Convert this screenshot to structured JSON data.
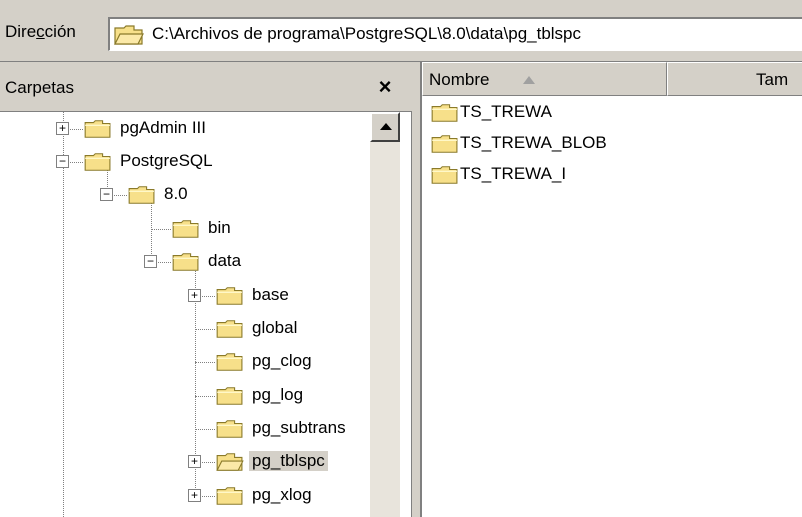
{
  "addressbar": {
    "label_prefix": "Dire",
    "label_accel": "c",
    "label_suffix": "ción",
    "path": "C:\\Archivos de programa\\PostgreSQL\\8.0\\data\\pg_tblspc"
  },
  "leftpane": {
    "title": "Carpetas",
    "close_glyph": "×"
  },
  "tree": [
    {
      "label": "pgAdmin III",
      "expander": "+"
    },
    {
      "label": "PostgreSQL",
      "expander": "−"
    },
    {
      "label": "8.0",
      "expander": "−"
    },
    {
      "label": "bin",
      "expander": ""
    },
    {
      "label": "data",
      "expander": "−"
    },
    {
      "label": "base",
      "expander": "+"
    },
    {
      "label": "global",
      "expander": ""
    },
    {
      "label": "pg_clog",
      "expander": ""
    },
    {
      "label": "pg_log",
      "expander": ""
    },
    {
      "label": "pg_subtrans",
      "expander": ""
    },
    {
      "label": "pg_tblspc",
      "expander": "+",
      "selected": true
    },
    {
      "label": "pg_xlog",
      "expander": "+"
    }
  ],
  "list": {
    "columns": [
      "Nombre",
      "Tam"
    ],
    "items": [
      "TS_TREWA",
      "TS_TREWA_BLOB",
      "TS_TREWA_I"
    ]
  },
  "icons": {
    "folder": "folder-icon",
    "open_folder": "open-folder-icon"
  },
  "colors": {
    "chrome": "#d4d0c8",
    "folder_fill": "#f7e08a",
    "folder_stroke": "#8a7a2a"
  }
}
